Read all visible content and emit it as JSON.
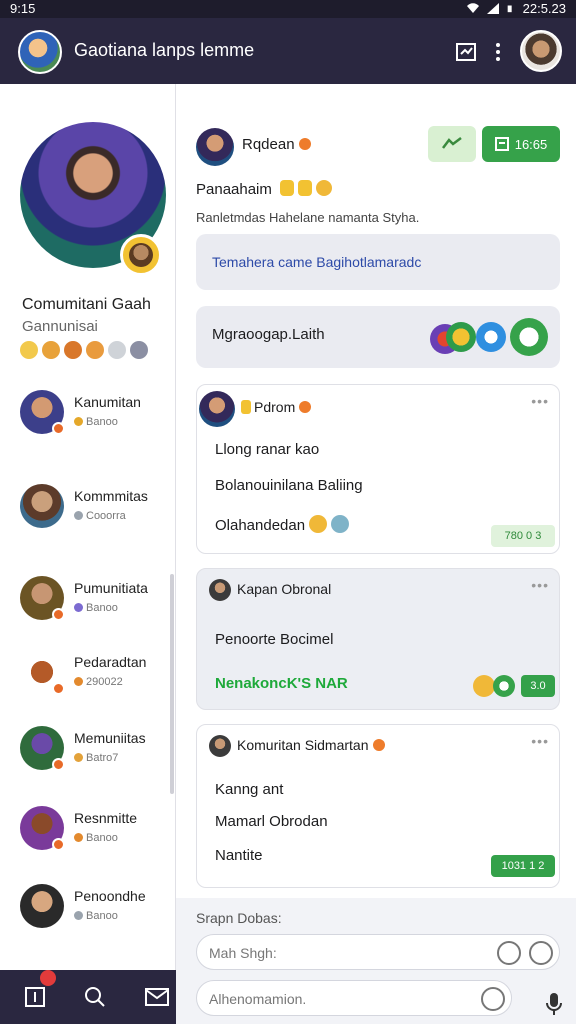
{
  "status_bar": {
    "time": "9:15",
    "right_time": "22:5.23"
  },
  "app_bar": {
    "title": "Gaotiana lanps lemme"
  },
  "sidebar": {
    "profile_name": "Comumitani Gaah",
    "profile_sub": "Gannunisai",
    "items": [
      {
        "name": "Kanumitan",
        "sub": "Banoo"
      },
      {
        "name": "Kommmitas",
        "sub": "Cooorra"
      },
      {
        "name": "Pumunitiata",
        "sub": "Banoo"
      },
      {
        "name": "Pedaradtan",
        "sub": "290022"
      },
      {
        "name": "Memuniitas",
        "sub": "Batro7"
      },
      {
        "name": "Resnmitte",
        "sub": "Banoo"
      },
      {
        "name": "Penoondhe",
        "sub": "Banoo"
      }
    ]
  },
  "post": {
    "author": "Rqdean",
    "button_count": "16:65",
    "title": "Panaahaim",
    "description": "Ranletmdas Hahelane namanta Styha.",
    "link_text": "Temahera came Bagihotlamaradc",
    "reaction_title": "Mgraoogap.Laith"
  },
  "cards": [
    {
      "author": "Pdrom",
      "lines": [
        "Llong ranar kao",
        "Bolanouinilana Baliing",
        "Olahandedan"
      ],
      "chip": "780 0 3"
    },
    {
      "author": "Kapan Obronal",
      "lines": [
        "Penoorte Bocimel"
      ],
      "highlight": "NenakoncK'S NAR",
      "chip": "3.0"
    },
    {
      "author": "Komuritan Sidmartan",
      "lines": [
        "Kanng ant",
        "Mamarl Obrodan",
        "Nantite"
      ],
      "chip": "1031 1 2"
    }
  ],
  "comment": {
    "label": "Srapn Dobas:",
    "placeholder": "Mah Shgh:",
    "second_placeholder": "Alhenomamion."
  }
}
